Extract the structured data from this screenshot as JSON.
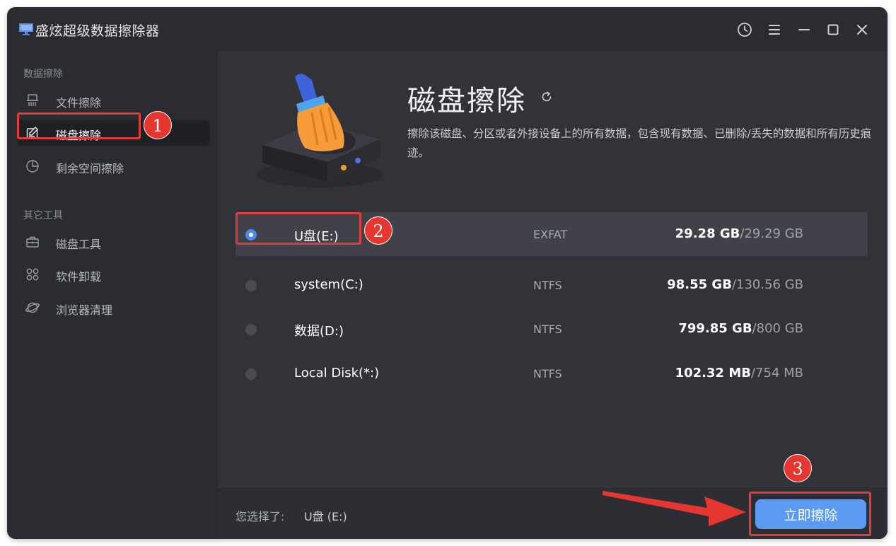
{
  "app": {
    "title": "盛炫超级数据擦除器"
  },
  "sidebar": {
    "section1_title": "数据擦除",
    "section2_title": "其它工具",
    "items": [
      {
        "label": "文件擦除",
        "icon": "file-shred-icon"
      },
      {
        "label": "磁盘擦除",
        "icon": "disk-edit-icon",
        "active": true
      },
      {
        "label": "剩余空间擦除",
        "icon": "pie-chart-icon"
      },
      {
        "label": "磁盘工具",
        "icon": "toolbox-icon"
      },
      {
        "label": "软件卸载",
        "icon": "apps-grid-icon"
      },
      {
        "label": "浏览器清理",
        "icon": "browser-icon"
      }
    ]
  },
  "main": {
    "title": "磁盘擦除",
    "description": "擦除该磁盘、分区或者外接设备上的所有数据，包含现有数据、已删除/丢失的数据和所有历史痕迹。",
    "disks": [
      {
        "name": "U盘(E:)",
        "fs": "EXFAT",
        "used": "29.28 GB",
        "total": "/29.29 GB",
        "selected": true
      },
      {
        "name": "system(C:)",
        "fs": "NTFS",
        "used": "98.55 GB",
        "total": "/130.56 GB",
        "selected": false
      },
      {
        "name": "数据(D:)",
        "fs": "NTFS",
        "used": "799.85 GB",
        "total": "/800 GB",
        "selected": false
      },
      {
        "name": "Local Disk(*:)",
        "fs": "NTFS",
        "used": "102.32 MB",
        "total": "/754 MB",
        "selected": false
      }
    ]
  },
  "footer": {
    "selection_label": "您选择了:",
    "selection_value": "U盘 (E:)",
    "wipe_button": "立即擦除"
  },
  "annotations": {
    "badge1": "1",
    "badge2": "2",
    "badge3": "3",
    "color": "#e23b3b"
  },
  "colors": {
    "accent": "#5a9af0",
    "sidebar_bg": "#2b2c31",
    "main_bg": "#323338"
  }
}
